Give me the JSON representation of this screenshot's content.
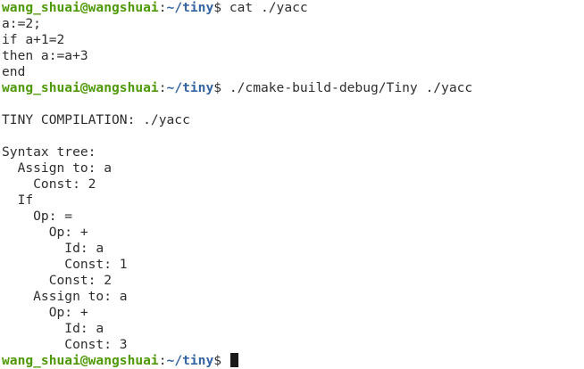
{
  "prompt": {
    "user_host": "wang_shuai@wangshuai",
    "separator": ":",
    "path": "~/tiny",
    "symbol": "$",
    "colors": {
      "user_host": "#4e9a06",
      "path": "#3465a4",
      "text": "#2e2e2e"
    }
  },
  "lines": [
    {
      "type": "prompt",
      "command": " cat ./yacc"
    },
    {
      "type": "output",
      "text": "a:=2;"
    },
    {
      "type": "output",
      "text": "if a+1=2"
    },
    {
      "type": "output",
      "text": "then a:=a+3"
    },
    {
      "type": "output",
      "text": "end"
    },
    {
      "type": "prompt",
      "command": " ./cmake-build-debug/Tiny ./yacc"
    },
    {
      "type": "output",
      "text": ""
    },
    {
      "type": "output",
      "text": "TINY COMPILATION: ./yacc"
    },
    {
      "type": "output",
      "text": ""
    },
    {
      "type": "output",
      "text": "Syntax tree:"
    },
    {
      "type": "output",
      "text": "  Assign to: a"
    },
    {
      "type": "output",
      "text": "    Const: 2"
    },
    {
      "type": "output",
      "text": "  If"
    },
    {
      "type": "output",
      "text": "    Op: ="
    },
    {
      "type": "output",
      "text": "      Op: +"
    },
    {
      "type": "output",
      "text": "        Id: a"
    },
    {
      "type": "output",
      "text": "        Const: 1"
    },
    {
      "type": "output",
      "text": "      Const: 2"
    },
    {
      "type": "output",
      "text": "    Assign to: a"
    },
    {
      "type": "output",
      "text": "      Op: +"
    },
    {
      "type": "output",
      "text": "        Id: a"
    },
    {
      "type": "output",
      "text": "        Const: 3"
    },
    {
      "type": "prompt",
      "command": " ",
      "cursor": true
    }
  ]
}
